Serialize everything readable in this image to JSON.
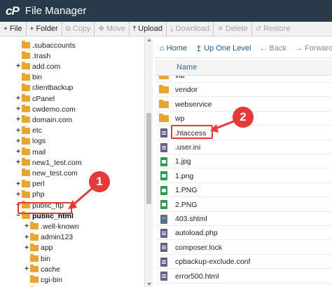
{
  "app": {
    "logo": "cP",
    "title": "File Manager"
  },
  "toolbar": [
    {
      "icon": "+",
      "label": "File",
      "enabled": true,
      "name": "new-file-button"
    },
    {
      "icon": "+",
      "label": "Folder",
      "enabled": true,
      "name": "new-folder-button"
    },
    {
      "icon": "⧉",
      "label": "Copy",
      "enabled": false,
      "name": "copy-button"
    },
    {
      "icon": "✥",
      "label": "Move",
      "enabled": false,
      "name": "move-button"
    },
    {
      "icon": "⤒",
      "label": "Upload",
      "enabled": true,
      "name": "upload-button"
    },
    {
      "icon": "⤓",
      "label": "Download",
      "enabled": false,
      "name": "download-button"
    },
    {
      "icon": "✕",
      "label": "Delete",
      "enabled": false,
      "name": "delete-button"
    },
    {
      "icon": "↺",
      "label": "Restore",
      "enabled": false,
      "name": "restore-button"
    }
  ],
  "tree": [
    {
      "label": ".subaccounts",
      "expandable": false,
      "indent": 0
    },
    {
      "label": ".trash",
      "expandable": false,
      "indent": 0
    },
    {
      "label": "add.com",
      "expandable": true,
      "indent": 0
    },
    {
      "label": "bin",
      "expandable": false,
      "indent": 0
    },
    {
      "label": "clientbackup",
      "expandable": false,
      "indent": 0
    },
    {
      "label": "cPanel",
      "expandable": true,
      "indent": 0
    },
    {
      "label": "cwdemo.com",
      "expandable": true,
      "indent": 0
    },
    {
      "label": "domain.com",
      "expandable": true,
      "indent": 0
    },
    {
      "label": "etc",
      "expandable": true,
      "indent": 0
    },
    {
      "label": "logs",
      "expandable": true,
      "indent": 0
    },
    {
      "label": "mail",
      "expandable": true,
      "indent": 0
    },
    {
      "label": "new1_test.com",
      "expandable": true,
      "indent": 0
    },
    {
      "label": "new_test.com",
      "expandable": false,
      "indent": 0
    },
    {
      "label": "perl",
      "expandable": true,
      "indent": 0
    },
    {
      "label": "php",
      "expandable": true,
      "indent": 0
    },
    {
      "label": "public_ftp",
      "expandable": true,
      "indent": 0
    },
    {
      "label": "public_html",
      "expandable": false,
      "indent": 0,
      "selected": true,
      "minus": true
    },
    {
      "label": ".well-known",
      "expandable": true,
      "indent": 1
    },
    {
      "label": "admin123",
      "expandable": true,
      "indent": 1
    },
    {
      "label": "app",
      "expandable": true,
      "indent": 1
    },
    {
      "label": "bin",
      "expandable": false,
      "indent": 1
    },
    {
      "label": "cache",
      "expandable": true,
      "indent": 1
    },
    {
      "label": "cgi-bin",
      "expandable": false,
      "indent": 1
    },
    {
      "label": "classes",
      "expandable": true,
      "indent": 1
    }
  ],
  "nav": [
    {
      "icon": "⌂",
      "label": "Home",
      "enabled": true,
      "name": "home-button"
    },
    {
      "icon": "↥",
      "label": "Up One Level",
      "enabled": true,
      "name": "up-one-level-button"
    },
    {
      "icon": "←",
      "label": "Back",
      "enabled": false,
      "name": "back-button"
    },
    {
      "icon": "→",
      "label": "Forward",
      "enabled": false,
      "name": "forward-button"
    }
  ],
  "list_header": {
    "name": "Name"
  },
  "files": [
    {
      "name": "var",
      "type": "folder"
    },
    {
      "name": "vendor",
      "type": "folder"
    },
    {
      "name": "webservice",
      "type": "folder"
    },
    {
      "name": "wp",
      "type": "folder"
    },
    {
      "name": ".htaccess",
      "type": "doc"
    },
    {
      "name": ".user.ini",
      "type": "doc"
    },
    {
      "name": "1.jpg",
      "type": "img"
    },
    {
      "name": "1.png",
      "type": "img"
    },
    {
      "name": "1.PNG",
      "type": "img"
    },
    {
      "name": "2.PNG",
      "type": "img"
    },
    {
      "name": "403.shtml",
      "type": "code"
    },
    {
      "name": "autoload.php",
      "type": "doc"
    },
    {
      "name": "composer.lock",
      "type": "doc"
    },
    {
      "name": "cpbackup-exclude.conf",
      "type": "doc"
    },
    {
      "name": "error500.html",
      "type": "doc"
    }
  ],
  "callouts": {
    "one": "1",
    "two": "2"
  },
  "colors": {
    "accent": "#e53a3a",
    "folder": "#e8a530",
    "titlebar": "#293a4a",
    "link": "#1c5a8e"
  }
}
